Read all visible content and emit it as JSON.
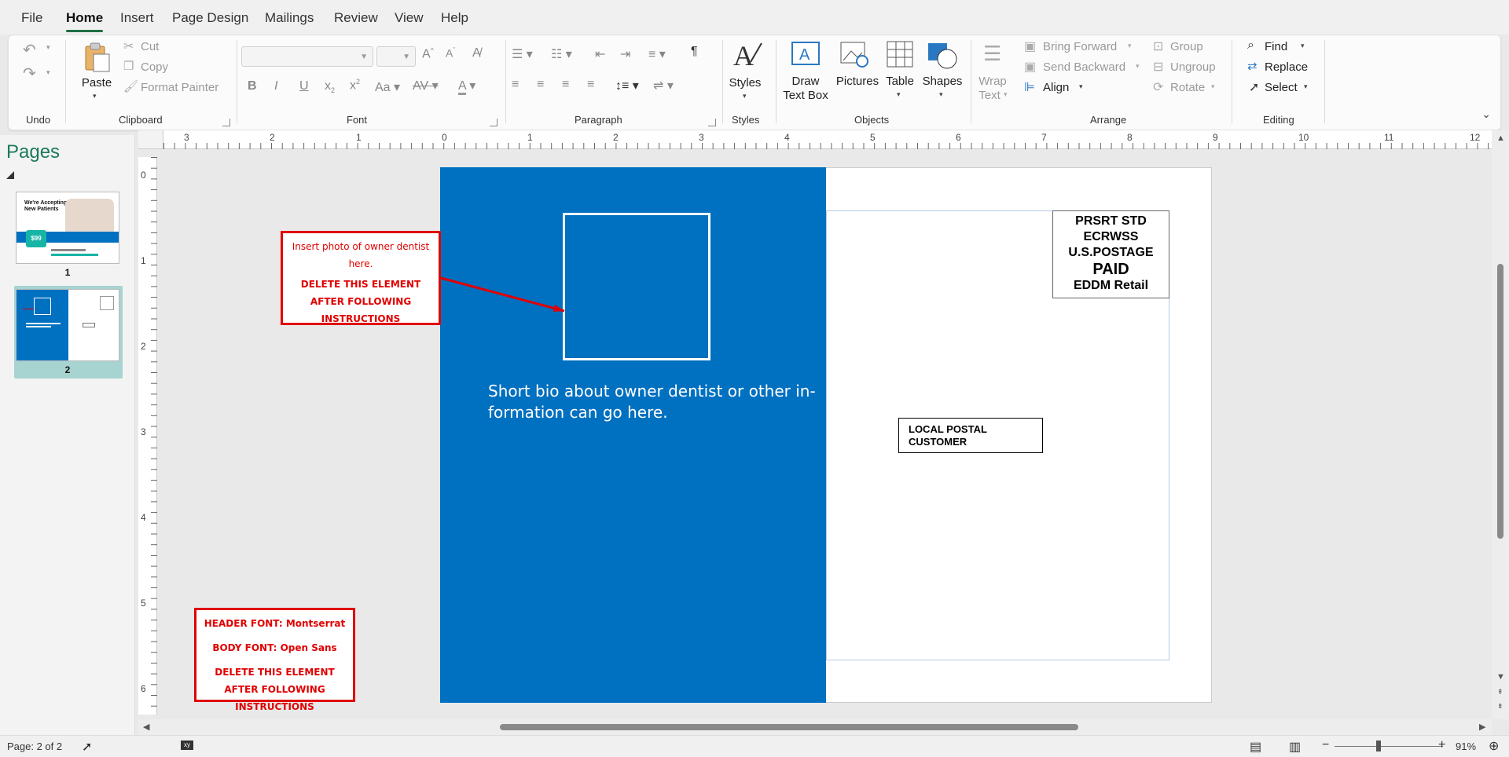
{
  "menu": {
    "tabs": [
      "File",
      "Home",
      "Insert",
      "Page Design",
      "Mailings",
      "Review",
      "View",
      "Help"
    ],
    "active": "Home"
  },
  "ribbon": {
    "undo": {
      "group_label": "Undo"
    },
    "clipboard": {
      "paste_label": "Paste",
      "cut_label": "Cut",
      "copy_label": "Copy",
      "format_painter_label": "Format Painter",
      "group_label": "Clipboard"
    },
    "font": {
      "group_label": "Font",
      "font_name": "",
      "font_size": ""
    },
    "paragraph": {
      "group_label": "Paragraph"
    },
    "styles": {
      "styles_label": "Styles",
      "group_label": "Styles"
    },
    "objects": {
      "draw_text_box_line1": "Draw",
      "draw_text_box_line2": "Text Box",
      "pictures_label": "Pictures",
      "table_label": "Table",
      "shapes_label": "Shapes",
      "group_label": "Objects"
    },
    "arrange": {
      "wrap_text_line1": "Wrap",
      "wrap_text_line2": "Text",
      "bring_forward_label": "Bring Forward",
      "send_backward_label": "Send Backward",
      "align_label": "Align",
      "group_btn_label": "Group",
      "ungroup_label": "Ungroup",
      "rotate_label": "Rotate",
      "group_label": "Arrange"
    },
    "editing": {
      "find_label": "Find",
      "replace_label": "Replace",
      "select_label": "Select",
      "group_label": "Editing"
    }
  },
  "pages_pane": {
    "title": "Pages",
    "pages": [
      {
        "number": "1",
        "thumb_text_line1": "We're Accepting",
        "thumb_text_line2": "New Patients",
        "thumb_price": "$99"
      },
      {
        "number": "2"
      }
    ]
  },
  "rulers": {
    "horizontal": [
      "3",
      "2",
      "1",
      "0",
      "1",
      "2",
      "3",
      "4",
      "5",
      "6",
      "7",
      "8",
      "9",
      "10",
      "11",
      "12"
    ],
    "vertical": [
      "0",
      "1",
      "2",
      "3",
      "4",
      "5",
      "6"
    ]
  },
  "document": {
    "bio_text": "Short bio about owner dentist or other in-formation can go here.",
    "postage": {
      "line1": "PRSRT STD",
      "line2": "ECRWSS",
      "line3": "U.S.POSTAGE",
      "line4": "PAID",
      "line5": "EDDM Retail"
    },
    "local_postal_line1": "LOCAL POSTAL",
    "local_postal_line2": "CUSTOMER",
    "note_photo": {
      "line1": "Insert photo of owner dentist here.",
      "line2": "DELETE THIS ELEMENT AFTER FOLLOWING INSTRUCTIONS"
    },
    "note_fonts": {
      "header_font": "HEADER FONT: Montserrat",
      "body_font": "BODY FONT: Open Sans",
      "delete_line": "DELETE THIS ELEMENT AFTER FOLLOWING INSTRUCTIONS"
    }
  },
  "status": {
    "page_indicator": "Page: 2 of 2",
    "zoom": "91%"
  },
  "colors": {
    "blue_panel": "#0070c0",
    "note_red": "#e00000",
    "accent_green": "#1f6f43",
    "thumb_highlight": "#a7d3d0"
  }
}
